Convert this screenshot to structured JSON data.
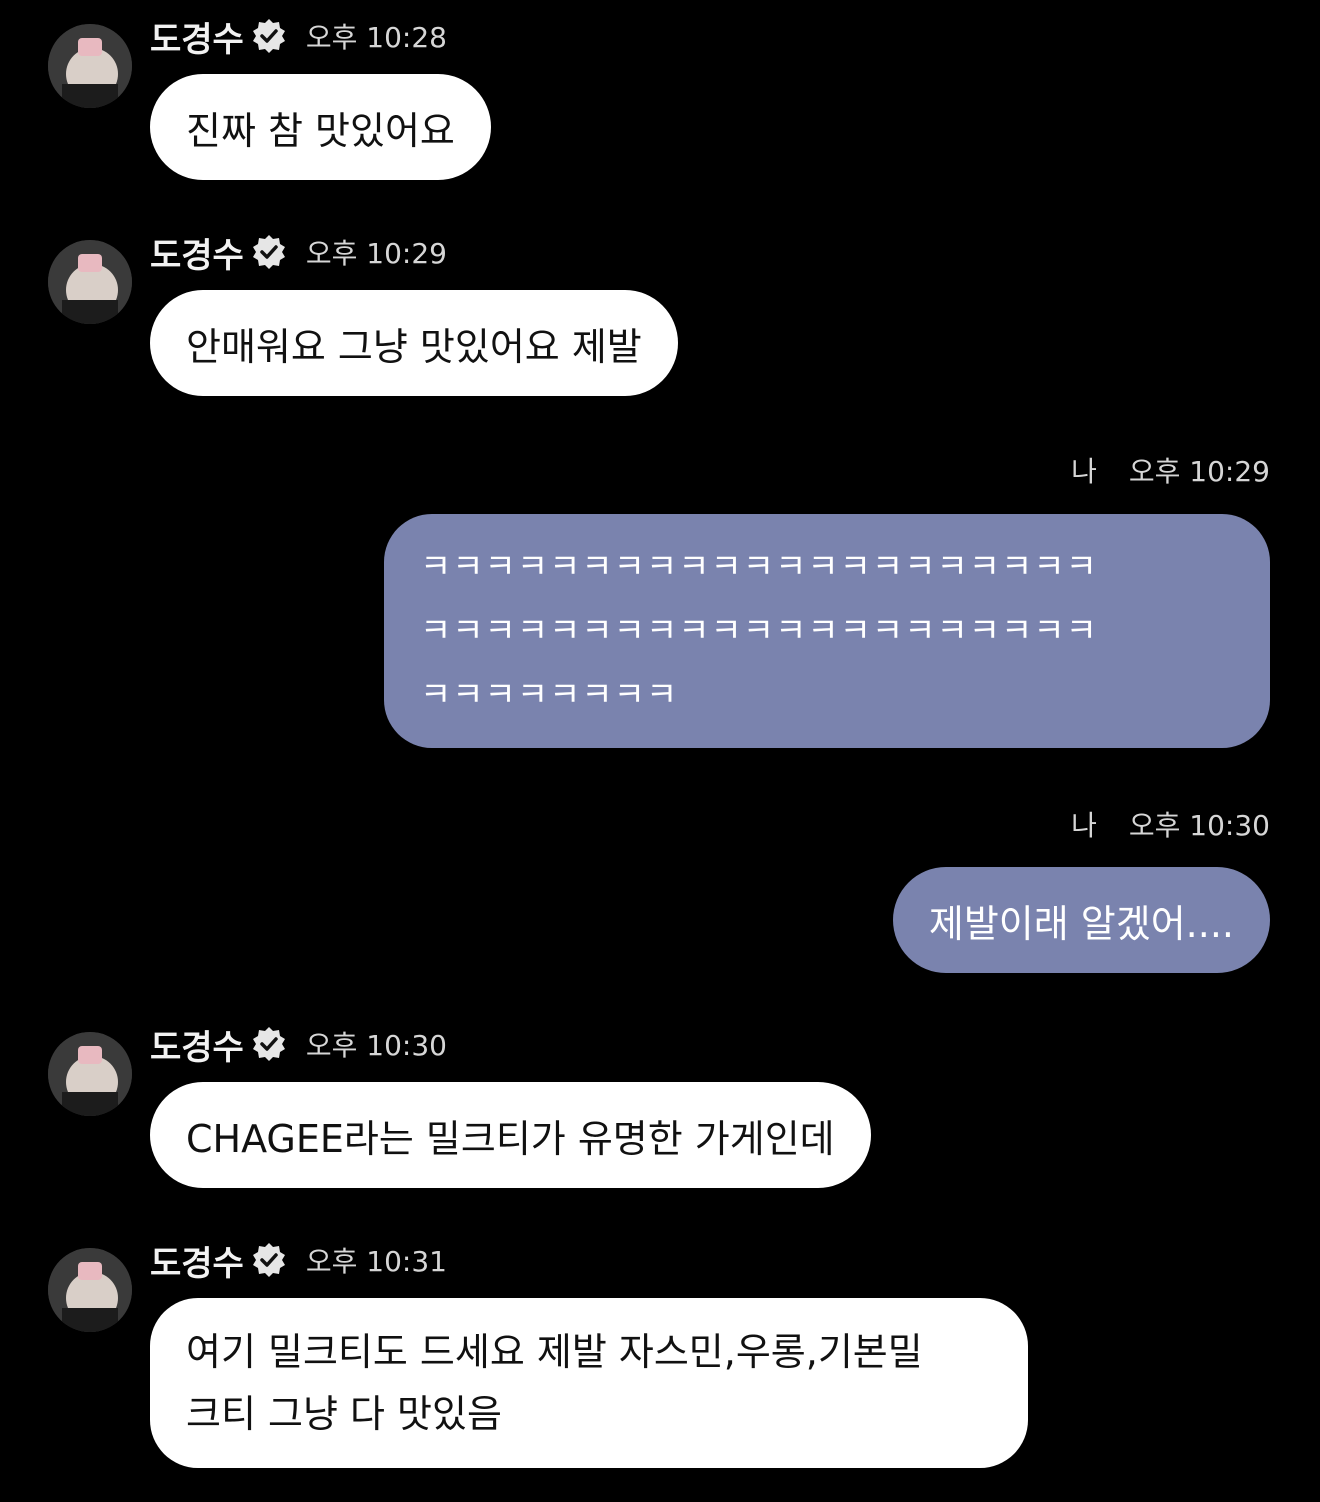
{
  "conversation": {
    "messages": [
      {
        "direction": "incoming",
        "sender": "도경수",
        "verified": true,
        "time": "오후 10:28",
        "lines": [
          "진짜 참 맛있어요"
        ]
      },
      {
        "direction": "incoming",
        "sender": "도경수",
        "verified": true,
        "time": "오후 10:29",
        "lines": [
          "안매워요 그냥 맛있어요 제발"
        ]
      },
      {
        "direction": "outgoing",
        "sender": "나",
        "time": "오후 10:29",
        "lines": [
          "ㅋㅋㅋㅋㅋㅋㅋㅋㅋㅋㅋㅋㅋㅋㅋㅋㅋㅋㅋㅋㅋ",
          "ㅋㅋㅋㅋㅋㅋㅋㅋㅋㅋㅋㅋㅋㅋㅋㅋㅋㅋㅋㅋㅋ",
          "ㅋㅋㅋㅋㅋㅋㅋㅋ"
        ]
      },
      {
        "direction": "outgoing",
        "sender": "나",
        "time": "오후 10:30",
        "lines": [
          "제발이래 알겠어...."
        ]
      },
      {
        "direction": "incoming",
        "sender": "도경수",
        "verified": true,
        "time": "오후 10:30",
        "lines": [
          "CHAGEE라는 밀크티가 유명한 가게인데"
        ]
      },
      {
        "direction": "incoming",
        "sender": "도경수",
        "verified": true,
        "time": "오후 10:31",
        "lines": [
          "여기 밀크티도 드세요 제발 자스민,우롱,기본밀",
          "크티 그냥 다 맛있음"
        ]
      }
    ]
  },
  "colors": {
    "background": "#000000",
    "incoming_bubble": "#ffffff",
    "outgoing_bubble": "#7a83ae",
    "meta_text": "#d6d6d6"
  },
  "icons": {
    "verified": "verified-badge-icon",
    "avatar": "avatar"
  }
}
